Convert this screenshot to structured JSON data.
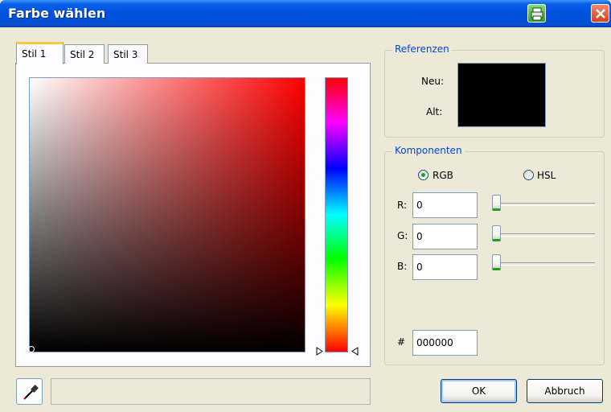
{
  "window": {
    "title": "Farbe wählen"
  },
  "titlebar": {
    "print_icon": "printer-icon",
    "close_icon": "close-icon"
  },
  "tabs": [
    {
      "label": "Stil 1",
      "active": true
    },
    {
      "label": "Stil 2",
      "active": false
    },
    {
      "label": "Stil 3",
      "active": false
    }
  ],
  "color_picker": {
    "base_hue_color": "#ff0000",
    "selected_color": "#000000"
  },
  "references": {
    "legend": "Referenzen",
    "new_label": "Neu:",
    "old_label": "Alt:",
    "new_color": "#000000",
    "old_color": "#000000"
  },
  "components": {
    "legend": "Komponenten",
    "mode_rgb": "RGB",
    "mode_hsl": "HSL",
    "selected_mode": "RGB",
    "r_label": "R:",
    "g_label": "G:",
    "b_label": "B:",
    "r_value": "0",
    "g_value": "0",
    "b_value": "0",
    "hex_label": "#",
    "hex_value": "000000"
  },
  "buttons": {
    "ok": "OK",
    "cancel": "Abbruch"
  },
  "eyedropper": {
    "icon": "eyedropper-icon"
  }
}
